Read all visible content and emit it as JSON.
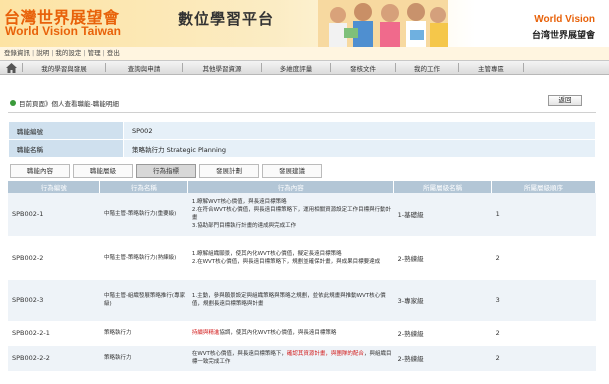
{
  "header": {
    "org_name_zh": "台灣世界展望會",
    "org_name_en": "World Vision Taiwan",
    "platform_title": "數位學習平台",
    "brand_en": "World Vision",
    "brand_zh": "台湾世界展望會"
  },
  "user_links": [
    "登錄資訊",
    "說明",
    "我的設定",
    "管理",
    "登出"
  ],
  "nav": {
    "items": [
      "我的學習與發展",
      "查詢與申請",
      "其他學習資源",
      "多維度評量",
      "發核文件",
      "我的工作",
      "主管專區"
    ]
  },
  "breadcrumb": "目前頁面》個人查看職能-職能明細",
  "back_label": "返回",
  "info": {
    "rows": [
      {
        "key": "職能編號",
        "value": "SP002"
      },
      {
        "key": "職能名稱",
        "value": "策略執行力 Strategic Planning"
      }
    ]
  },
  "tabs": [
    "職能內容",
    "職能層級",
    "行為指標",
    "發展計劃",
    "發展建議"
  ],
  "active_tab": "行為指標",
  "table": {
    "headers": [
      "行為編號",
      "行為名稱",
      "行為內容",
      "所屬層級名稱",
      "所屬層級順序"
    ],
    "rows": [
      {
        "id": "SPB002-1",
        "name": "中階主管-策略執行力(重要級)",
        "content": [
          "1.瞭解WVT核心價值，與長遠目標策略",
          "2.在符合WVT核心價值，與長遠目標策略下，運用相關資源設定工作目標與行動計畫",
          "3.協助部門目標執行計畫的達成與完成工作"
        ],
        "level_name": "1-基礎級",
        "level_order": "1"
      },
      {
        "id": "SPB002-2",
        "name": "中階主管-策略執行力(熟練級)",
        "content": [
          "1.瞭解組織願景，使其內化WVT核心價值，擬定長遠目標策略",
          "2.在WVT核心價值，與長遠目標策略下，規劃並確保計畫，與成果目標要達成"
        ],
        "level_name": "2-熟練級",
        "level_order": "2"
      },
      {
        "id": "SPB002-3",
        "name": "中階主管-組織發展策略推行(專家級)",
        "content": [
          "1.主動，參與願景設定與組織策略與策略之規劃，並依此規畫與推動WVT核心價值，規劃長遠目標策略與計畫"
        ],
        "level_name": "3-專家級",
        "level_order": "3"
      },
      {
        "id": "SPB002-2-1",
        "name": "策略執行力",
        "content_red": "持續與精進",
        "content": [
          "協調，使其內化WVT核心價值，與長遠目標策略"
        ],
        "level_name": "2-熟練級",
        "level_order": "2"
      },
      {
        "id": "SPB002-2-2",
        "name": "策略執行力",
        "content": [
          "在WVT核心價值，與長遠目標策略下，"
        ],
        "content_red": "確認其資源計畫，與團隊的配合",
        "content_tail": "，與組織目標一致完成工作",
        "level_name": "2-熟練級",
        "level_order": "2"
      }
    ]
  },
  "colors": {
    "brand_orange": "#e8620a",
    "header_row": "#b3c6d6",
    "info_key_bg": "#cfe0ee",
    "highlight_red": "#d21a1a"
  }
}
